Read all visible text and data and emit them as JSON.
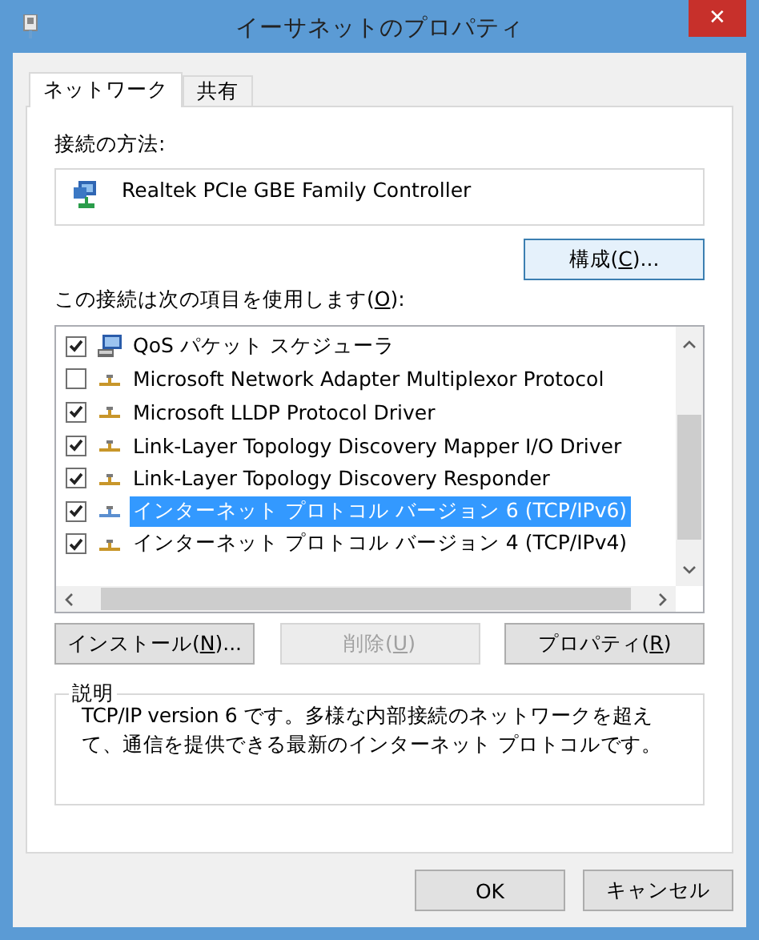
{
  "window": {
    "title": "イーサネットのプロパティ",
    "close": "✕"
  },
  "tabs": [
    {
      "label": "ネットワーク",
      "selected": true
    },
    {
      "label": "共有",
      "selected": false
    }
  ],
  "connect_using": {
    "label": "接続の方法:",
    "adapter": "Realtek PCIe GBE Family Controller"
  },
  "configure_button": {
    "label_parts": [
      "構成(",
      "C",
      ")..."
    ],
    "disabled": false
  },
  "items_label": {
    "label_parts": [
      "この接続は次の項目を使用します(",
      "O",
      "):"
    ]
  },
  "items": [
    {
      "kind": "service",
      "label": "QoS パケット スケジューラ",
      "checked": true,
      "selected": false
    },
    {
      "kind": "protocol",
      "label": "Microsoft Network Adapter Multiplexor Protocol",
      "checked": false,
      "selected": false
    },
    {
      "kind": "protocol",
      "label": "Microsoft LLDP Protocol Driver",
      "checked": true,
      "selected": false
    },
    {
      "kind": "protocol",
      "label": "Link-Layer Topology Discovery Mapper I/O Driver",
      "checked": true,
      "selected": false
    },
    {
      "kind": "protocol",
      "label": "Link-Layer Topology Discovery Responder",
      "checked": true,
      "selected": false
    },
    {
      "kind": "protocol",
      "label": "インターネット プロトコル バージョン 6 (TCP/IPv6)",
      "checked": true,
      "selected": true
    },
    {
      "kind": "protocol",
      "label": "インターネット プロトコル バージョン 4 (TCP/IPv4)",
      "checked": true,
      "selected": false
    }
  ],
  "item_buttons": [
    {
      "label_parts": [
        "インストール(",
        "N",
        ")..."
      ],
      "disabled": false
    },
    {
      "label_parts": [
        "削除(",
        "U",
        ")"
      ],
      "disabled": true
    },
    {
      "label_parts": [
        "プロパティ(",
        "R",
        ")"
      ],
      "disabled": false
    }
  ],
  "description": {
    "label": "説明",
    "text": "TCP/IP version 6 です。多様な内部接続のネットワークを超えて、通信を提供できる最新のインターネット プロトコルです。"
  },
  "dialog_buttons": [
    {
      "label_parts": [
        "OK"
      ],
      "disabled": false
    },
    {
      "label_parts": [
        "キャンセル"
      ],
      "disabled": false
    }
  ]
}
